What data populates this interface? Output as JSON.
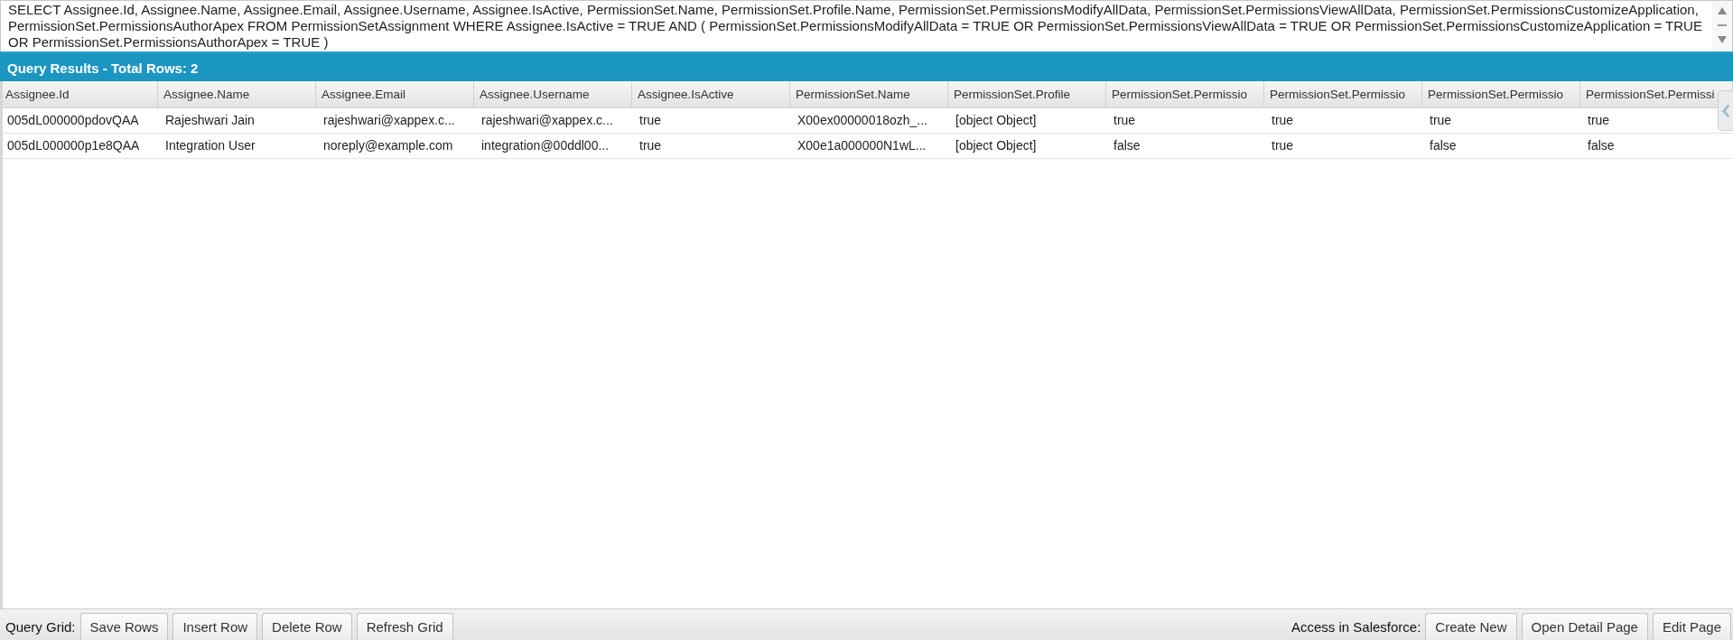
{
  "query_editor": {
    "text": "SELECT Assignee.Id, Assignee.Name, Assignee.Email, Assignee.Username, Assignee.IsActive, PermissionSet.Name, PermissionSet.Profile.Name, PermissionSet.PermissionsModifyAllData, PermissionSet.PermissionsViewAllData, PermissionSet.PermissionsCustomizeApplication, PermissionSet.PermissionsAuthorApex FROM PermissionSetAssignment WHERE Assignee.IsActive = TRUE AND ( PermissionSet.PermissionsModifyAllData = TRUE OR PermissionSet.PermissionsViewAllData = TRUE OR PermissionSet.PermissionsCustomizeApplication = TRUE OR PermissionSet.PermissionsAuthorApex = TRUE )"
  },
  "results_header": {
    "title": "Query Results - Total Rows: 2"
  },
  "grid": {
    "columns": [
      "Assignee.Id",
      "Assignee.Name",
      "Assignee.Email",
      "Assignee.Username",
      "Assignee.IsActive",
      "PermissionSet.Name",
      "PermissionSet.Profile",
      "PermissionSet.Permissio",
      "PermissionSet.Permissio",
      "PermissionSet.Permissio",
      "PermissionSet.Permissi"
    ],
    "rows": [
      {
        "cells": [
          "005dL000000pdovQAA",
          "Rajeshwari Jain",
          "rajeshwari@xappex.c...",
          "rajeshwari@xappex.c...",
          "true",
          "X00ex00000018ozh_...",
          "[object Object]",
          "true",
          "true",
          "true",
          "true"
        ]
      },
      {
        "cells": [
          "005dL000000p1e8QAA",
          "Integration User",
          "noreply@example.com",
          "integration@00ddl00...",
          "true",
          "X00e1a000000N1wL...",
          "[object Object]",
          "false",
          "true",
          "false",
          "false"
        ]
      }
    ]
  },
  "toolbar": {
    "left_label": "Query Grid:",
    "left_buttons": [
      "Save Rows",
      "Insert Row",
      "Delete Row",
      "Refresh Grid"
    ],
    "right_label": "Access in Salesforce:",
    "right_buttons": [
      "Create New",
      "Open Detail Page",
      "Edit Page"
    ]
  }
}
